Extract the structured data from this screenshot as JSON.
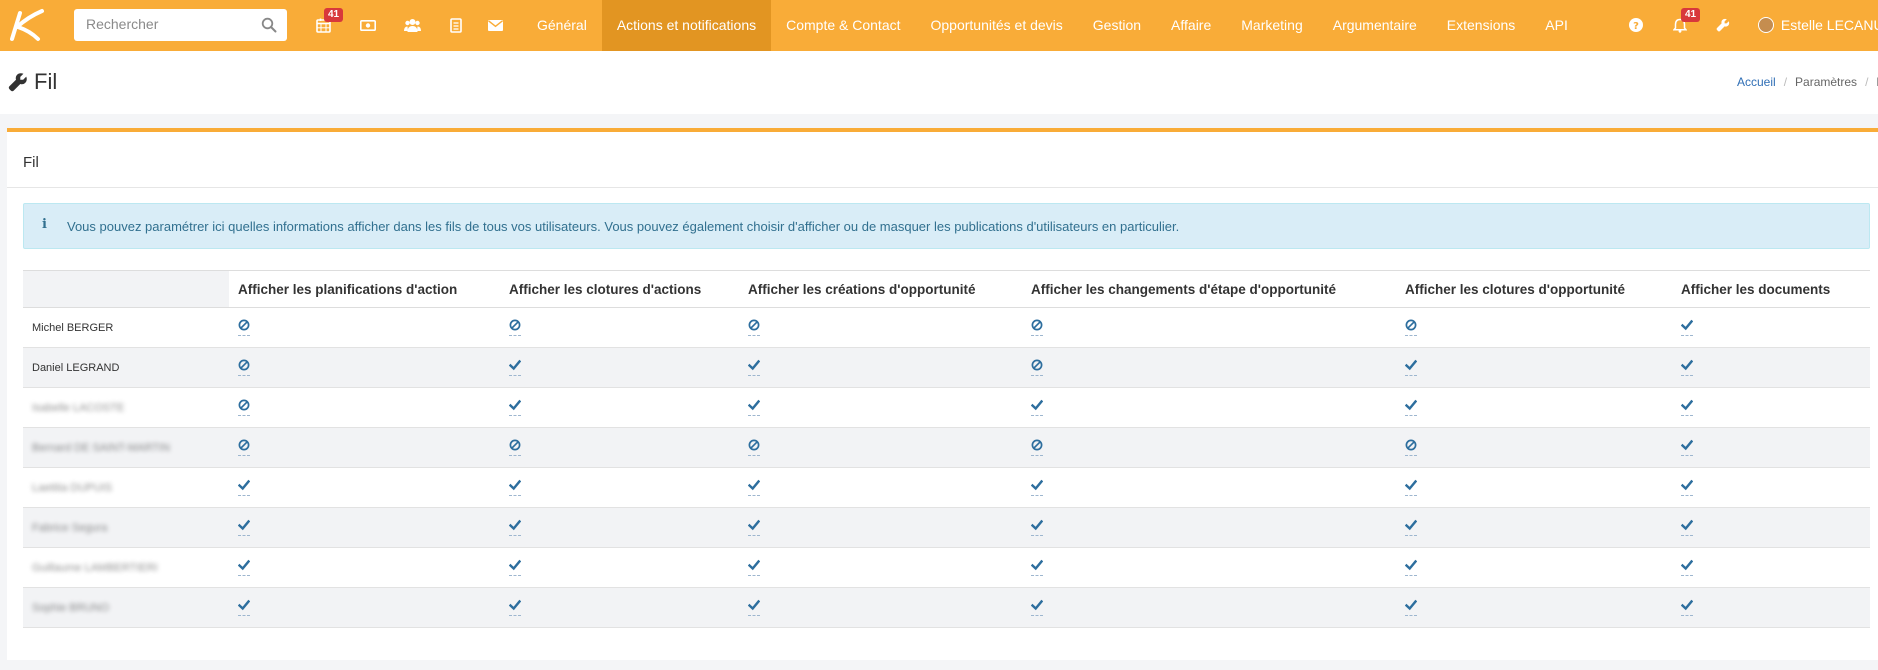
{
  "header": {
    "search_placeholder": "Rechercher",
    "badges": {
      "calendar": "41",
      "notifications": "41"
    },
    "nav": [
      "Général",
      "Actions et notifications",
      "Compte & Contact",
      "Opportunités et devis",
      "Gestion",
      "Affaire",
      "Marketing",
      "Argumentaire",
      "Extensions",
      "API"
    ],
    "active_nav": "Actions et notifications",
    "user": "Estelle LECANU"
  },
  "page": {
    "title": "Fil",
    "breadcrumb": [
      "Accueil",
      "Paramètres",
      "Fi"
    ]
  },
  "panel": {
    "title": "Fil",
    "info_text": "Vous pouvez paramétrer ici quelles informations afficher dans les fils de tous vos utilisateurs. Vous pouvez également choisir d'afficher ou de masquer les publications d'utilisateurs en particulier.",
    "table": {
      "columns": [
        "Afficher les planifications d'action",
        "Afficher les clotures d'actions",
        "Afficher les créations d'opportunité",
        "Afficher les changements d'étape d'opportunité",
        "Afficher les clotures d'opportunité",
        "Afficher les documents"
      ],
      "rows": [
        {
          "name": "Michel BERGER",
          "blurred": false,
          "values": [
            "off",
            "off",
            "off",
            "off",
            "off",
            "on"
          ]
        },
        {
          "name": "Daniel LEGRAND",
          "blurred": false,
          "values": [
            "off",
            "on",
            "on",
            "off",
            "on",
            "on"
          ]
        },
        {
          "name": "Isabelle LACOSTE",
          "blurred": true,
          "values": [
            "off",
            "on",
            "on",
            "on",
            "on",
            "on"
          ]
        },
        {
          "name": "Bernard DE SAINT-MARTIN",
          "blurred": true,
          "values": [
            "off",
            "off",
            "off",
            "off",
            "off",
            "on"
          ]
        },
        {
          "name": "Laetitia DUPUIS",
          "blurred": true,
          "values": [
            "on",
            "on",
            "on",
            "on",
            "on",
            "on"
          ]
        },
        {
          "name": "Fabrice Segura",
          "blurred": true,
          "values": [
            "on",
            "on",
            "on",
            "on",
            "on",
            "on"
          ]
        },
        {
          "name": "Guillaume LAMBERTIERI",
          "blurred": true,
          "values": [
            "on",
            "on",
            "on",
            "on",
            "on",
            "on"
          ]
        },
        {
          "name": "Sophie BRUNO",
          "blurred": true,
          "values": [
            "on",
            "on",
            "on",
            "on",
            "on",
            "on"
          ]
        }
      ]
    }
  },
  "icons": {
    "on": "check-icon",
    "off": "ban-icon"
  },
  "colors": {
    "topbar": "#f9ac38",
    "active_nav": "#e29522",
    "badge": "#d8383b",
    "status_icon": "#2d6e9e",
    "info_bg": "#d9edf7",
    "info_text": "#31708f"
  }
}
